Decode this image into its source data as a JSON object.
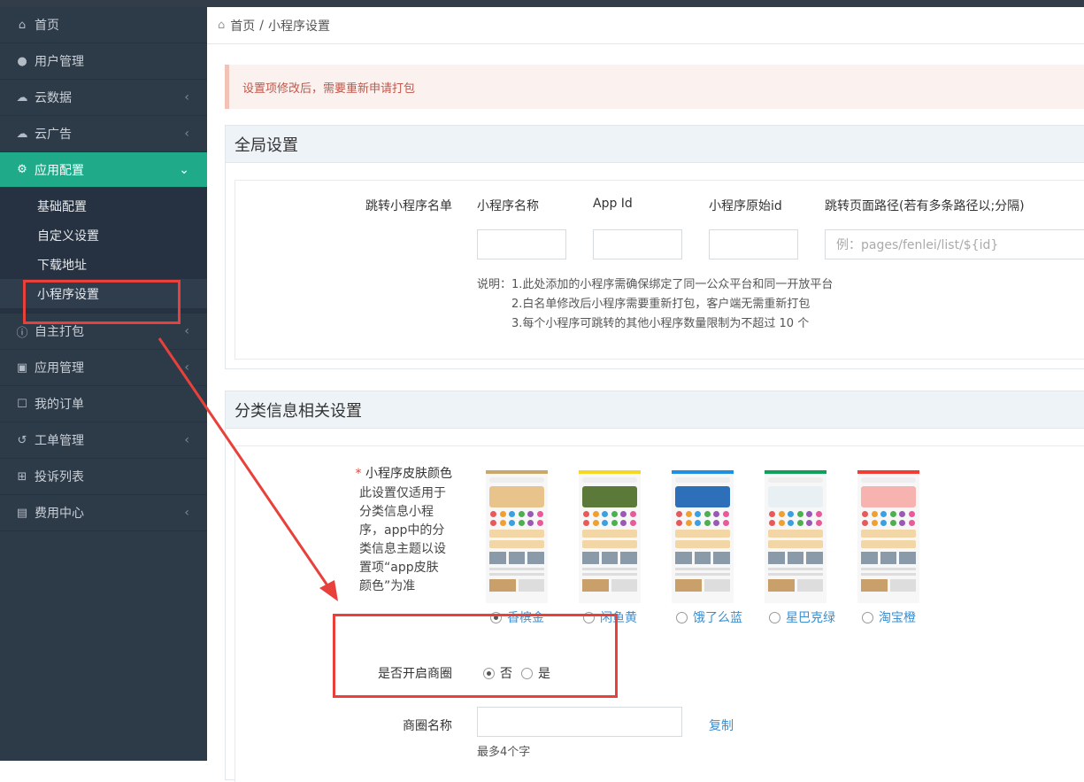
{
  "sidebar": {
    "items": [
      {
        "label": "首页",
        "icon": "home-icon"
      },
      {
        "label": "用户管理",
        "icon": "users-icon"
      },
      {
        "label": "云数据",
        "icon": "cloud-icon"
      },
      {
        "label": "云广告",
        "icon": "cloud-icon"
      },
      {
        "label": "应用配置",
        "icon": "gears-icon"
      },
      {
        "label": "自主打包",
        "icon": "info-icon"
      },
      {
        "label": "应用管理",
        "icon": "apps-icon"
      },
      {
        "label": "我的订单",
        "icon": "cart-icon"
      },
      {
        "label": "工单管理",
        "icon": "history-icon"
      },
      {
        "label": "投诉列表",
        "icon": "plus-square-icon"
      },
      {
        "label": "费用中心",
        "icon": "money-icon"
      }
    ],
    "sub_items": [
      {
        "label": "基础配置"
      },
      {
        "label": "自定义设置"
      },
      {
        "label": "下载地址"
      },
      {
        "label": "小程序设置"
      }
    ]
  },
  "breadcrumb": {
    "home": "首页",
    "separator": "/",
    "current": "小程序设置"
  },
  "alert": {
    "text": "设置项修改后，需要重新申请打包"
  },
  "global_settings": {
    "title": "全局设置",
    "row_label": "跳转小程序名单",
    "columns": [
      {
        "label": "小程序名称"
      },
      {
        "label": "App Id"
      },
      {
        "label": "小程序原始id"
      },
      {
        "label": "跳转页面路径(若有多条路径以;分隔)"
      }
    ],
    "path_placeholder": "例：pages/fenlei/list/${id}",
    "notes": [
      "说明：1.此处添加的小程序需确保绑定了同一公众平台和同一开放平台",
      "2.白名单修改后小程序需要重新打包，客户端无需重新打包",
      "3.每个小程序可跳转的其他小程序数量限制为不超过 10 个"
    ]
  },
  "category_settings": {
    "title": "分类信息相关设置",
    "skin_label_required": "*",
    "skin_label": "小程序皮肤颜色",
    "skin_desc": [
      "此设置仅适用于",
      "分类信息小程",
      "序，app中的分",
      "类信息主题以设",
      "置项“app皮肤",
      "颜色”为准"
    ],
    "skins": [
      {
        "label": "香槟金",
        "color": "#c9a86a",
        "banner": "#e8c48c",
        "checked": true
      },
      {
        "label": "闲鱼黄",
        "color": "#f5d823",
        "banner": "#5b7a3a",
        "checked": false
      },
      {
        "label": "饿了么蓝",
        "color": "#1e8fe1",
        "banner": "#2d6fb8",
        "checked": false
      },
      {
        "label": "星巴克绿",
        "color": "#10a05a",
        "banner": "#e9f0f3",
        "checked": false
      },
      {
        "label": "淘宝橙",
        "color": "#f23e32",
        "banner": "#f6b3b0",
        "checked": false
      }
    ],
    "circle_label": "是否开启商圈",
    "circle_options": [
      {
        "label": "否",
        "checked": true
      },
      {
        "label": "是",
        "checked": false
      }
    ],
    "circle_name_label": "商圈名称",
    "copy_label": "复制",
    "circle_name_hint": "最多4个字"
  },
  "colors": {
    "accent": "#1fab89",
    "sidebar_bg": "#2d3a48",
    "annotation_red": "#e8403a",
    "link": "#3b8fd1"
  }
}
